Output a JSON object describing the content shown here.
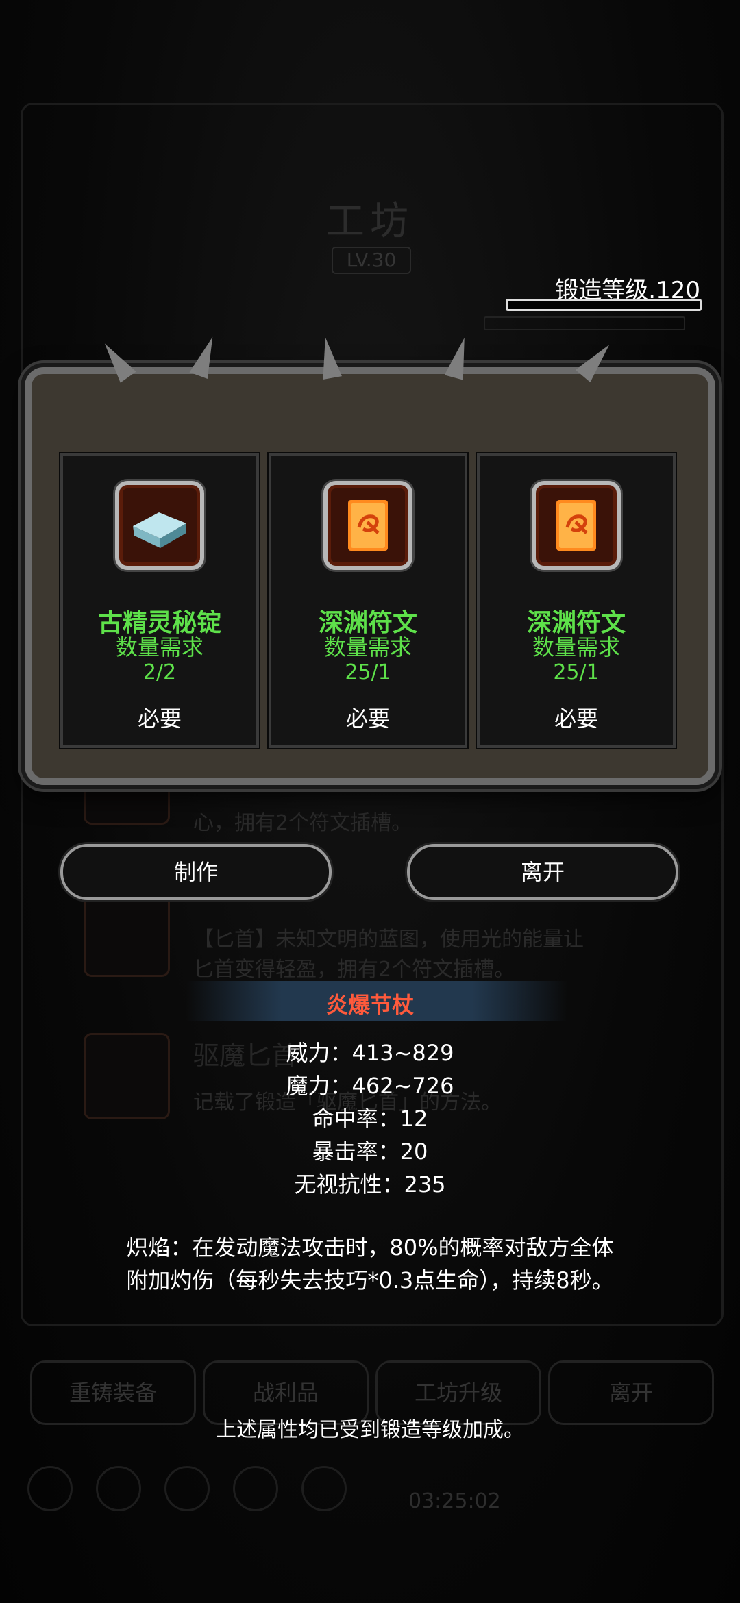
{
  "background": {
    "workshop_title": "工坊",
    "workshop_level": "LV.30",
    "list_text_1": "心，拥有2个符文插槽。",
    "list_text_2": "【匕首】未知文明的蓝图，使用光的能量让",
    "list_text_3": "匕首变得轻盈，拥有2个符文插槽。",
    "list_item_title": "驱魔匕首",
    "list_text_4": "记载了锻造「驱魔匕首」的方法。",
    "bottom_buttons": [
      "重铸装备",
      "战利品",
      "工坊升级",
      "离开"
    ],
    "timer": "03:25:02"
  },
  "forge": {
    "label": "锻造等级.120",
    "progress": 0.0
  },
  "materials": [
    {
      "name": "古精灵秘锭",
      "requirement_label": "数量需求",
      "count": "2/2",
      "status": "必要",
      "icon": "silver-ingot-icon"
    },
    {
      "name": "深渊符文",
      "requirement_label": "数量需求",
      "count": "25/1",
      "status": "必要",
      "icon": "rune-scroll-icon"
    },
    {
      "name": "深渊符文",
      "requirement_label": "数量需求",
      "count": "25/1",
      "status": "必要",
      "icon": "rune-scroll-icon"
    }
  ],
  "actions": {
    "craft_label": "制作",
    "leave_label": "离开"
  },
  "item": {
    "name": "炎爆节杖",
    "stats": [
      "威力：413~829",
      "魔力：462~726",
      "命中率：12",
      "暴击率：20",
      "无视抗性：235"
    ],
    "effect_line1": "炽焰：在发动魔法攻击时，80%的概率对敌方全体",
    "effect_line2": "附加灼伤（每秒失去技巧*0.3点生命），持续8秒。",
    "footnote": "上述属性均已受到锻造等级加成。"
  },
  "colors": {
    "material_text": "#5ee14a",
    "item_name": "#ff5a3c",
    "dialog_bg": "#3d3830"
  }
}
